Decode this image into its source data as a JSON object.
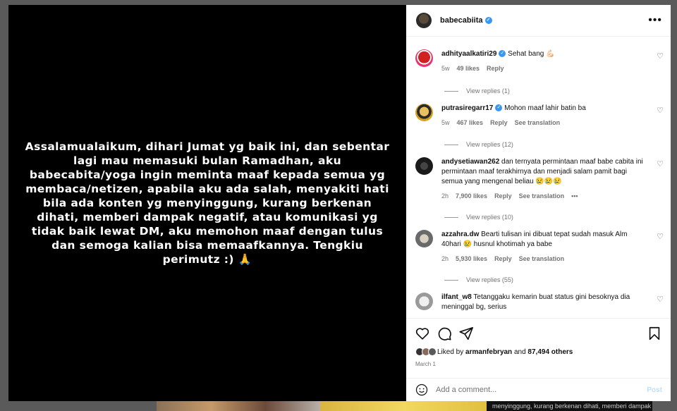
{
  "background": {
    "caption_fragment": "menyinggung, kurang berkenan dihati, memberi dampak"
  },
  "post": {
    "story_text": "Assalamualaikum, dihari Jumat yg baik ini, dan sebentar lagi mau memasuki bulan Ramadhan, aku babecabita/yoga ingin meminta maaf kepada semua yg membaca/netizen, apabila aku ada salah, menyakiti hati bila ada konten yg menyinggung, kurang berkenan dihati, memberi dampak negatif, atau komunikasi yg tidak baik lewat DM, aku memohon maaf dengan tulus dan semoga kalian bisa memaafkannya. Tengkiu perimutz :) 🙏"
  },
  "header": {
    "username": "babecabiita",
    "verified_mark": "✓",
    "more_label": "•••"
  },
  "comments": [
    {
      "username": "adhityaalkatiri29",
      "verified": "✓",
      "text": "Sehat bang 💪🏻",
      "age": "5w",
      "likes": "49 likes",
      "reply": "Reply",
      "see_translation": "",
      "view_replies": "View replies (1)"
    },
    {
      "username": "putrasiregarr17",
      "verified": "✓",
      "text": "Mohon maaf lahir batin ba",
      "age": "5w",
      "likes": "467 likes",
      "reply": "Reply",
      "see_translation": "See translation",
      "view_replies": "View replies (12)"
    },
    {
      "username": "andysetiawan262",
      "verified": "",
      "text": "dan ternyata permintaan maaf babe cabita ini permintaan maaf terakhirnya dan menjadi salam pamit bagi semua yang mengenal beliau 😢😢😢",
      "age": "2h",
      "likes": "7,900 likes",
      "reply": "Reply",
      "see_translation": "See translation",
      "more": "•••",
      "view_replies": "View replies (10)"
    },
    {
      "username": "azzahra.dw",
      "verified": "",
      "text": "Bearti tulisan ini dibuat tepat sudah masuk Alm 40hari 😢 husnul khotimah ya babe",
      "age": "2h",
      "likes": "5,930 likes",
      "reply": "Reply",
      "see_translation": "See translation",
      "view_replies": "View replies (55)"
    },
    {
      "username": "ilfant_w8",
      "verified": "",
      "text": "Tetanggaku kemarin buat status gini besoknya dia meninggal bg, serius"
    }
  ],
  "icons": {
    "heart": "♡",
    "heart_icon": "heart-icon",
    "comment_icon": "comment-icon",
    "share_icon": "share-icon",
    "save_icon": "bookmark-icon",
    "emoji_icon": "emoji-icon"
  },
  "likes": {
    "prefix": "Liked by",
    "user": "armanfebryan",
    "and_word": "and",
    "others": "87,494 others"
  },
  "date": "March 1",
  "add_comment": {
    "placeholder": "Add a comment...",
    "post_label": "Post"
  },
  "colors": {
    "verified": "#3897f0",
    "post_disabled": "#c0dffd"
  }
}
